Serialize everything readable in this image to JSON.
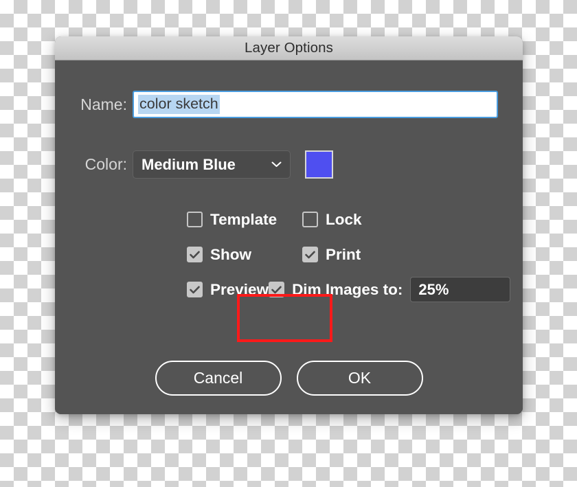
{
  "dialog": {
    "title": "Layer Options",
    "body_color": "#545454"
  },
  "name_row": {
    "label": "Name:",
    "value": "color sketch",
    "placeholder": "Layer name",
    "selection_color": "#b7d6f2",
    "focus_border_color": "#4a9de0"
  },
  "color_row": {
    "label": "Color:",
    "selected": "Medium Blue",
    "chevron_icon": "chevron-down-icon",
    "swatch_color": "#4f4ff0",
    "options": [
      "Medium Blue"
    ]
  },
  "checkboxes": {
    "template": {
      "label": "Template",
      "checked": false
    },
    "lock": {
      "label": "Lock",
      "checked": false
    },
    "show": {
      "label": "Show",
      "checked": true
    },
    "print": {
      "label": "Print",
      "checked": true
    },
    "preview": {
      "label": "Preview",
      "checked": true
    },
    "dim_images": {
      "label": "Dim Images to:",
      "checked": true,
      "value": "25%",
      "placeholder": "50%"
    }
  },
  "annotation": {
    "color": "#fc1a1a",
    "target": "dim-images-row"
  },
  "buttons": {
    "cancel": "Cancel",
    "ok": "OK"
  }
}
